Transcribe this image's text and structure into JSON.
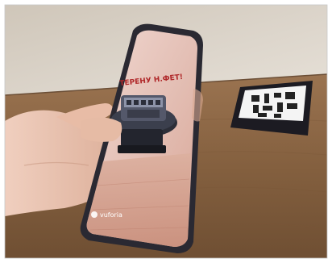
{
  "photo": {
    "ar_caption": "ТЕРЕНУ Н.ФЕТ!",
    "brand_text": "vuforia",
    "colors": {
      "wall": "#d8d0c4",
      "table": "#8a6442",
      "phone_body": "#24232b",
      "skin": "#e8c2ae",
      "ar_bg": "#e9cdc3"
    }
  }
}
